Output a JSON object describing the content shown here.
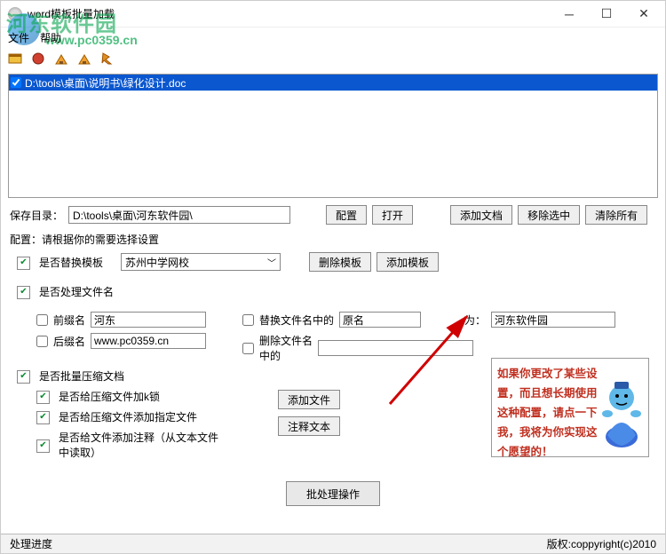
{
  "window": {
    "title": "word模板批量加载"
  },
  "menu": {
    "file": "文件",
    "help": "帮助"
  },
  "watermark": {
    "main": "河东软件园",
    "url": "www.pc0359.cn"
  },
  "fileList": {
    "items": [
      {
        "path": "D:\\tools\\桌面\\说明书\\绿化设计.doc",
        "checked": true
      }
    ]
  },
  "saveRow": {
    "label": "保存目录：",
    "path": "D:\\tools\\桌面\\河东软件园\\",
    "btnConfig": "配置",
    "btnOpen": "打开",
    "btnAddDoc": "添加文档",
    "btnRemoveSel": "移除选中",
    "btnClearAll": "清除所有"
  },
  "configHeader": "配置：请根据你的需要选择设置",
  "template": {
    "replaceLabel": "是否替换模板",
    "comboValue": "苏州中学网校",
    "btnDel": "删除模板",
    "btnAdd": "添加模板"
  },
  "fileName": {
    "processLabel": "是否处理文件名",
    "prefixLabel": "前缀名",
    "prefixValue": "河东",
    "suffixLabel": "后缀名",
    "suffixValue": "www.pc0359.cn",
    "replaceInName": "替换文件名中的",
    "origValue": "原名",
    "forLabel": "为：",
    "newValue": "河东软件园",
    "delInName": "删除文件名中的",
    "delValue": ""
  },
  "compress": {
    "batchLabel": "是否批量压缩文档",
    "lockLabel": "是否给压缩文件加k锁",
    "addFileLabel": "是否给压缩文件添加指定文件",
    "commentLabel": "是否给文件添加注释（从文本文件中读取）",
    "btnAddFile": "添加文件",
    "btnComment": "注释文本"
  },
  "hint": {
    "text": "如果你更改了某些设置，而且想长期使用这种配置，请点一下我，我将为你实现这个愿望的！"
  },
  "process": {
    "btn": "批处理操作"
  },
  "status": {
    "left": "处理进度",
    "right": "版权:coppyright(c)2010"
  }
}
